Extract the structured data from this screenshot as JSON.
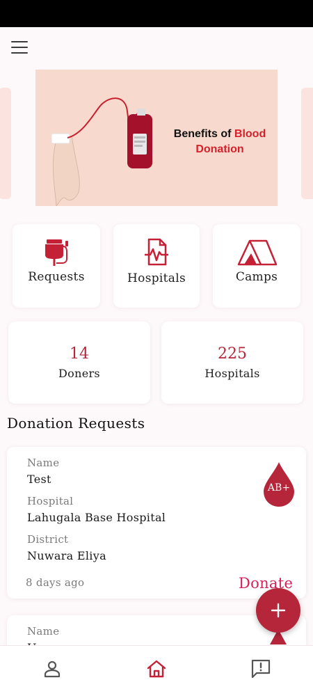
{
  "banner": {
    "title_part1": "Benefits of ",
    "title_highlight": "Blood",
    "title_part2": "Donation"
  },
  "quick_actions": [
    {
      "label": "Requests",
      "icon": "blood-bag-icon"
    },
    {
      "label": "Hospitals",
      "icon": "hospital-document-icon"
    },
    {
      "label": "Camps",
      "icon": "tent-icon"
    }
  ],
  "stats": [
    {
      "value": "14",
      "label": "Doners"
    },
    {
      "value": "225",
      "label": "Hospitals"
    }
  ],
  "section_title": "Donation Requests",
  "requests": [
    {
      "name_label": "Name",
      "name": "Test",
      "hospital_label": "Hospital",
      "hospital": "Lahugala Base Hospital",
      "district_label": "District",
      "district": "Nuwara Eliya",
      "time": "8 days ago",
      "blood_group": "AB+",
      "action": "Donate"
    },
    {
      "name_label": "Name",
      "name": "U...",
      "blood_group": "",
      "action": ""
    }
  ],
  "fab": {
    "icon": "plus-icon"
  },
  "bottom_nav": [
    {
      "icon": "person-icon",
      "active": false
    },
    {
      "icon": "home-icon",
      "active": true
    },
    {
      "icon": "feedback-icon",
      "active": false
    }
  ],
  "colors": {
    "accent": "#b5263b",
    "donate": "#d81f5a",
    "banner_bg": "#f7d9cd",
    "page_bg": "#fdf8fa"
  }
}
